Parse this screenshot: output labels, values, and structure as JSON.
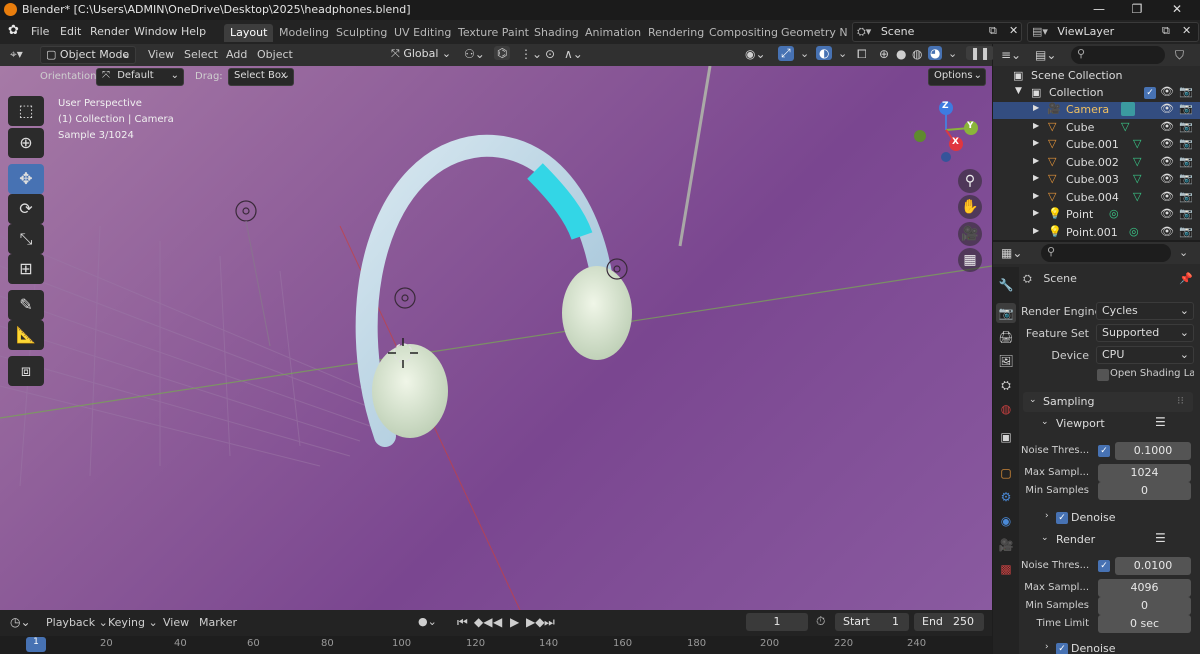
{
  "window": {
    "title": "Blender* [C:\\Users\\ADMIN\\OneDrive\\Desktop\\2025\\headphones.blend]",
    "minimize_glyph": "—",
    "maximize_glyph": "❐",
    "close_glyph": "✕"
  },
  "menu": {
    "items": [
      "File",
      "Edit",
      "Render",
      "Window",
      "Help"
    ]
  },
  "workspaces": {
    "tabs": [
      "Layout",
      "Modeling",
      "Sculpting",
      "UV Editing",
      "Texture Paint",
      "Shading",
      "Animation",
      "Rendering",
      "Compositing",
      "Geometry Noc"
    ],
    "active": "Layout"
  },
  "scene_selector": {
    "value": "Scene"
  },
  "viewlayer_selector": {
    "value": "ViewLayer"
  },
  "viewport_header": {
    "mode": "Object Mode",
    "menus": [
      "View",
      "Select",
      "Add",
      "Object"
    ],
    "transform_orientation": "Global"
  },
  "viewport_subheader": {
    "orientation_label": "Orientation:",
    "orientation_value": "Default",
    "drag_label": "Drag:",
    "drag_value": "Select Box",
    "options_label": "Options"
  },
  "viewport_overlay": {
    "line1": "User Perspective",
    "line2": "(1) Collection | Camera",
    "line3": "Sample 3/1024"
  },
  "gizmo": {
    "x": "X",
    "y": "Y",
    "z": "Z"
  },
  "timeline": {
    "menus": [
      "Playback",
      "Keying",
      "View",
      "Marker"
    ],
    "current_frame": "1",
    "start_label": "Start",
    "start_value": "1",
    "end_label": "End",
    "end_value": "250",
    "ruler_ticks": [
      "1",
      "20",
      "40",
      "60",
      "80",
      "100",
      "120",
      "140",
      "160",
      "180",
      "200",
      "220",
      "240"
    ]
  },
  "outliner": {
    "root": "Scene Collection",
    "collection": "Collection",
    "items": [
      {
        "name": "Camera",
        "selected": true
      },
      {
        "name": "Cube",
        "selected": false
      },
      {
        "name": "Cube.001",
        "selected": false
      },
      {
        "name": "Cube.002",
        "selected": false
      },
      {
        "name": "Cube.003",
        "selected": false
      },
      {
        "name": "Cube.004",
        "selected": false
      },
      {
        "name": "Point",
        "selected": false
      },
      {
        "name": "Point.001",
        "selected": false
      }
    ]
  },
  "properties": {
    "context": "Scene",
    "render_engine_label": "Render Engine",
    "render_engine_value": "Cycles",
    "feature_set_label": "Feature Set",
    "feature_set_value": "Supported",
    "device_label": "Device",
    "device_value": "CPU",
    "osl_label": "Open Shading La...",
    "sampling_label": "Sampling",
    "viewport_label": "Viewport",
    "vp_noise_label": "Noise Thres...",
    "vp_noise_value": "0.1000",
    "vp_max_label": "Max Sampl...",
    "vp_max_value": "1024",
    "vp_min_label": "Min Samples",
    "vp_min_value": "0",
    "vp_denoise_label": "Denoise",
    "render_label": "Render",
    "r_noise_label": "Noise Thres...",
    "r_noise_value": "0.0100",
    "r_max_label": "Max Sampl...",
    "r_max_value": "4096",
    "r_min_label": "Min Samples",
    "r_min_value": "0",
    "r_time_label": "Time Limit",
    "r_time_value": "0 sec",
    "r_denoise_label": "Denoise"
  },
  "colors": {
    "accent": "#4772b3",
    "blender_orange": "#e87d0d",
    "viewport_purple": "#8c5b98",
    "headband_cyan": "#33d6e6"
  }
}
